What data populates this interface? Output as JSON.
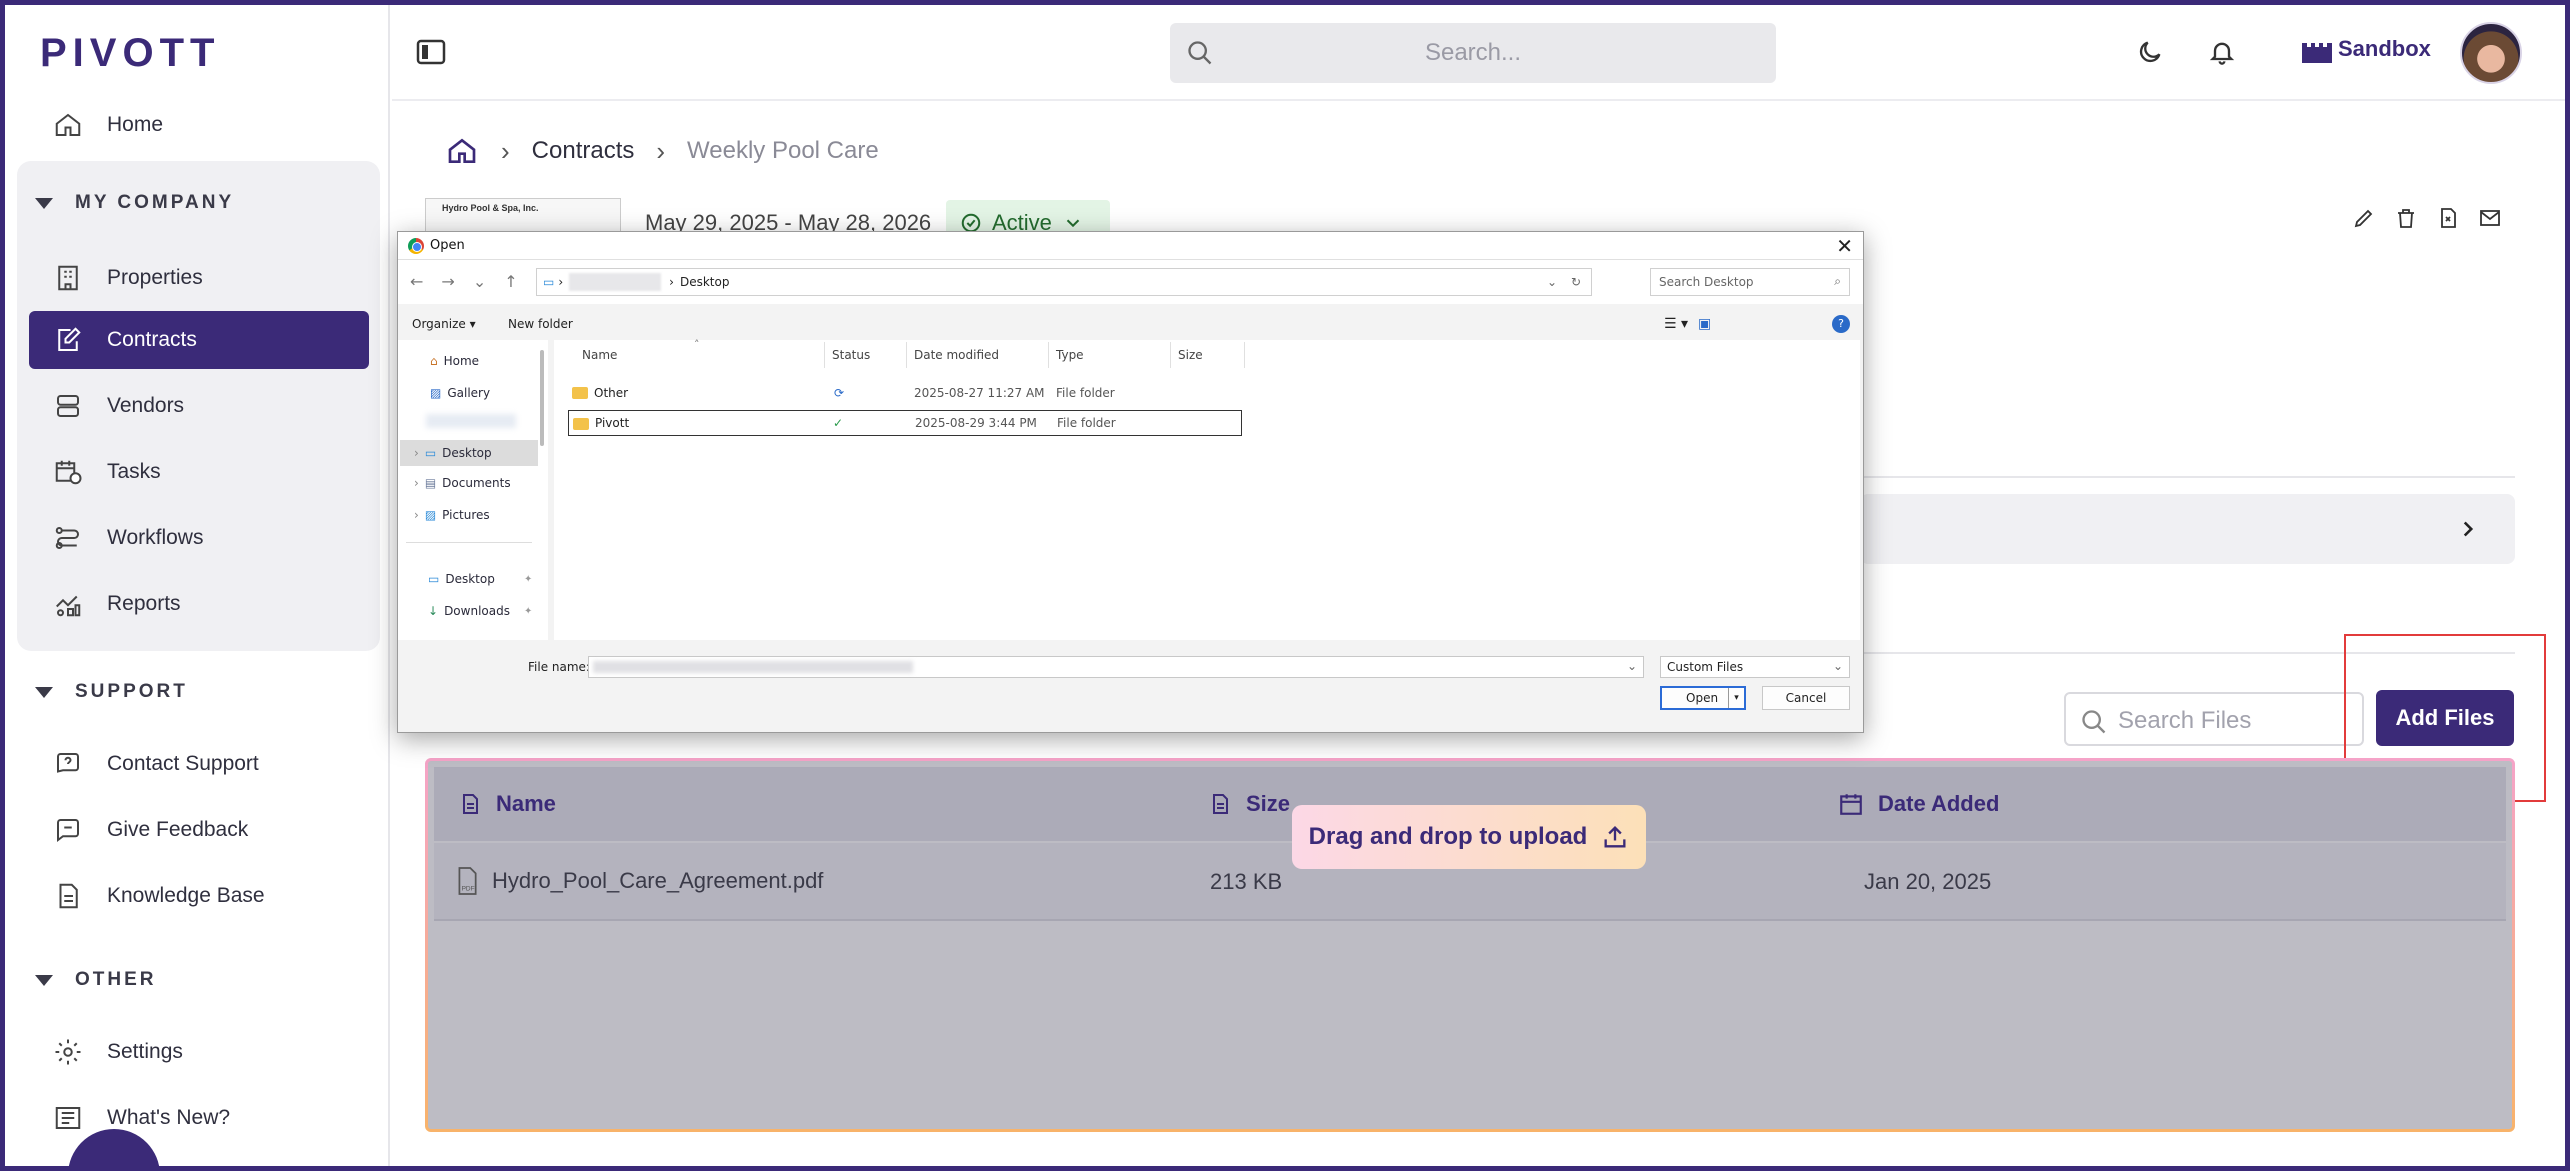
{
  "sidebar": {
    "logo": "PIVOTT",
    "home": "Home",
    "sections": [
      {
        "label": "MY COMPANY"
      },
      {
        "label": "SUPPORT"
      },
      {
        "label": "OTHER"
      }
    ],
    "company_items": [
      "Properties",
      "Contracts",
      "Vendors",
      "Tasks",
      "Workflows",
      "Reports"
    ],
    "support_items": [
      "Contact Support",
      "Give Feedback",
      "Knowledge Base"
    ],
    "other_items": [
      "Settings",
      "What's New?"
    ],
    "active_item": "Contracts"
  },
  "topbar": {
    "search_placeholder": "Search...",
    "org_name": "Sandbox"
  },
  "breadcrumb": {
    "items": [
      "Contracts",
      "Weekly Pool Care"
    ]
  },
  "contract": {
    "logo_text": "Hydro Pool & Spa, Inc.",
    "dates": "May 29, 2025 - May 28, 2026",
    "status": "Active"
  },
  "files": {
    "search_placeholder": "Search Files",
    "add_button": "Add Files",
    "drag_label": "Drag and drop to upload",
    "columns": [
      "Name",
      "Size",
      "Date Added"
    ],
    "rows": [
      {
        "name": "Hydro_Pool_Care_Agreement.pdf",
        "size": "213 KB",
        "date": "Jan 20, 2025"
      }
    ]
  },
  "dialog": {
    "title": "Open",
    "path_current": "Desktop",
    "search_placeholder": "Search Desktop",
    "organize": "Organize",
    "new_folder": "New folder",
    "nav_items": [
      "Home",
      "Gallery",
      "Desktop",
      "Documents",
      "Pictures",
      "Desktop",
      "Downloads"
    ],
    "columns": [
      "Name",
      "Status",
      "Date modified",
      "Type",
      "Size"
    ],
    "rows": [
      {
        "name": "Other",
        "modified": "2025-08-27 11:27 AM",
        "type": "File folder"
      },
      {
        "name": "Pivott",
        "modified": "2025-08-29 3:44 PM",
        "type": "File folder"
      }
    ],
    "file_name_label": "File name:",
    "file_type": "Custom Files",
    "open_button": "Open",
    "cancel_button": "Cancel"
  }
}
